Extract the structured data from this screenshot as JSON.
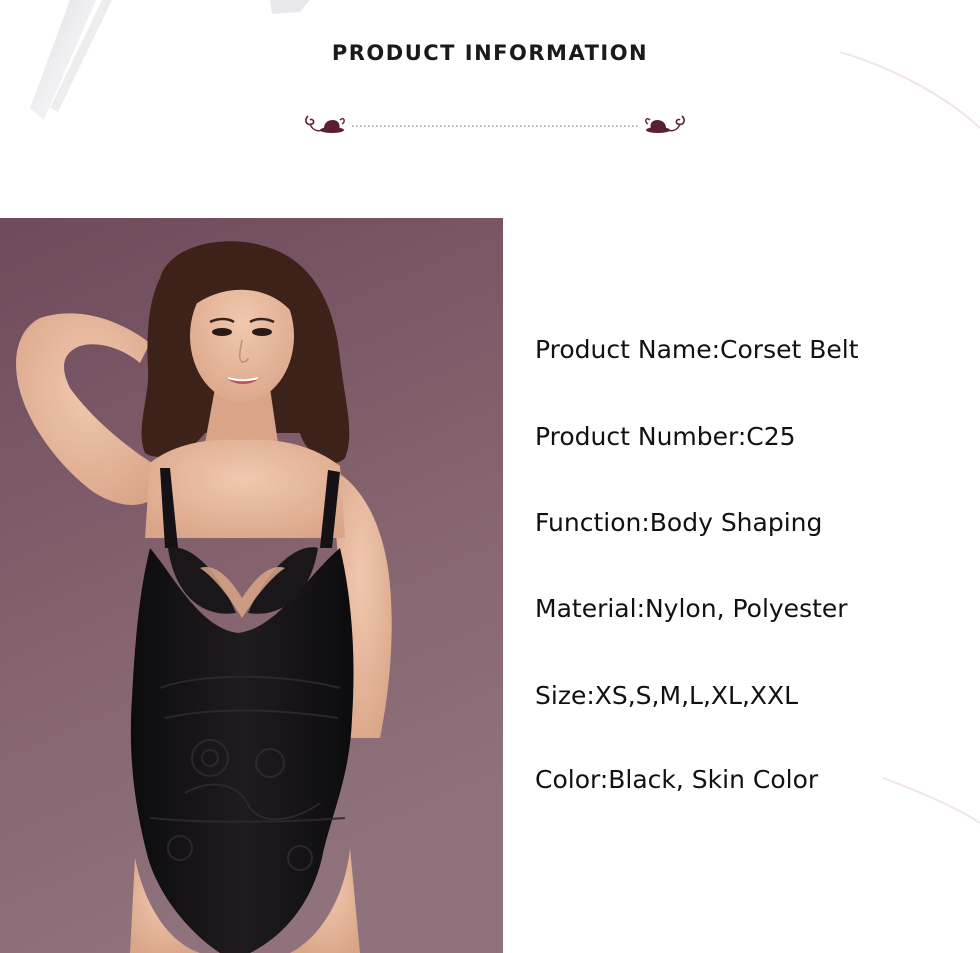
{
  "header": {
    "title": "PRODUCT INFORMATION"
  },
  "specs": [
    "Product Name:Corset Belt",
    "Product Number:C25",
    "Function:Body Shaping",
    "Material:Nylon, Polyester",
    "Size:XS,S,M,L,XL,XXL",
    "Color:Black, Skin Color"
  ],
  "colors": {
    "ornament": "#5a1f33",
    "photo_background_top": "#6e4a5c",
    "photo_background_bottom": "#8a6a76",
    "garment": "#141214",
    "skin": "#e7b89c",
    "hair": "#3d2219"
  },
  "icons": {
    "divider_left": "flourish-hat-icon",
    "divider_right": "flourish-hat-icon"
  }
}
